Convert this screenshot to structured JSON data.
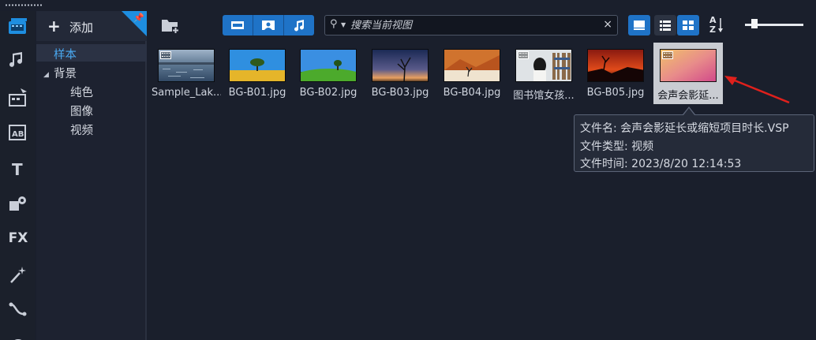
{
  "app": {
    "add_label": "添加",
    "accent_color": "#1f73c7"
  },
  "icon_bar": [
    {
      "icon": "media-icon",
      "active": true
    },
    {
      "icon": "audio-icon"
    },
    {
      "icon": "instant-project-icon"
    },
    {
      "icon": "transition-icon"
    },
    {
      "icon": "title-icon"
    },
    {
      "icon": "decoration-icon"
    },
    {
      "icon": "fx-icon",
      "text": "FX"
    },
    {
      "icon": "magic-wand-icon"
    },
    {
      "icon": "path-icon"
    }
  ],
  "tree": {
    "items": [
      {
        "label": "样本",
        "level": 0,
        "selected": true
      },
      {
        "label": "背景",
        "level": 0,
        "expanded": true
      },
      {
        "label": "纯色",
        "level": 1
      },
      {
        "label": "图像",
        "level": 1
      },
      {
        "label": "视频",
        "level": 1
      }
    ]
  },
  "toolbar": {
    "filters": [
      "video-filter-icon",
      "photo-filter-icon",
      "audio-filter-icon"
    ],
    "search_placeholder": "搜索当前视图",
    "view_modes": [
      "thumbnail-view-icon",
      "list-view-icon",
      "grid-view-icon"
    ],
    "sort_label_top": "A",
    "sort_label_bottom": "Z"
  },
  "library": {
    "items": [
      {
        "label": "Sample_Lak...",
        "type": "video",
        "thumb": "lake"
      },
      {
        "label": "BG-B01.jpg",
        "type": "image",
        "thumb": "tree-yellow"
      },
      {
        "label": "BG-B02.jpg",
        "type": "image",
        "thumb": "tree-green"
      },
      {
        "label": "BG-B03.jpg",
        "type": "image",
        "thumb": "tree-dusk"
      },
      {
        "label": "BG-B04.jpg",
        "type": "image",
        "thumb": "desert"
      },
      {
        "label": "图书馆女孩...",
        "type": "video",
        "thumb": "library"
      },
      {
        "label": "BG-B05.jpg",
        "type": "image",
        "thumb": "sunset"
      },
      {
        "label": "会声会影延...",
        "type": "video",
        "thumb": "pink",
        "selected": true
      }
    ]
  },
  "tooltip": {
    "name_line": "文件名: 会声会影延长或缩短项目时长.VSP",
    "type_line": "文件类型: 视频",
    "time_line": "文件时间: 2023/8/20 12:14:53"
  },
  "annotation": {
    "arrow_color": "#e0201c"
  }
}
